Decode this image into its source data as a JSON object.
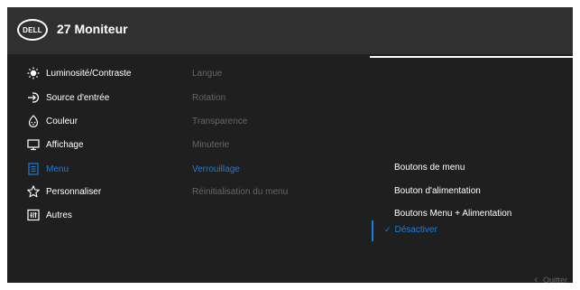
{
  "header": {
    "logo_text": "DELL",
    "title": "27 Moniteur"
  },
  "main_menu": [
    {
      "label": "Luminosité/Contraste",
      "icon": "brightness-icon"
    },
    {
      "label": "Source d'entrée",
      "icon": "input-source-icon"
    },
    {
      "label": "Couleur",
      "icon": "color-icon"
    },
    {
      "label": "Affichage",
      "icon": "display-icon"
    },
    {
      "label": "Menu",
      "icon": "menu-icon",
      "active": true
    },
    {
      "label": "Personnaliser",
      "icon": "star-icon"
    },
    {
      "label": "Autres",
      "icon": "others-icon"
    }
  ],
  "submenu": [
    {
      "label": "Langue"
    },
    {
      "label": "Rotation"
    },
    {
      "label": "Transparence"
    },
    {
      "label": "Minuterie"
    },
    {
      "label": "Verrouillage",
      "active": true
    },
    {
      "label": "Réinitialisation du menu"
    }
  ],
  "options": [
    {
      "label": "Boutons de menu"
    },
    {
      "label": "Bouton d'alimentation"
    },
    {
      "label": "Boutons Menu + Alimentation"
    },
    {
      "label": "Désactiver",
      "selected": true,
      "check": "✓"
    }
  ],
  "footer": {
    "quit_label": "Quitter",
    "quit_icon": "chevron-left-icon"
  },
  "colors": {
    "accent": "#1c7ce0",
    "background": "#1f1f1f",
    "header": "#303030",
    "inactive_text": "#666666"
  }
}
